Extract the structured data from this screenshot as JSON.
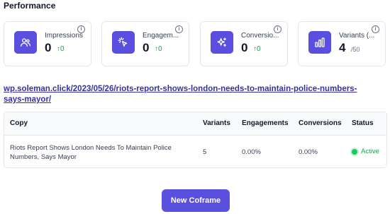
{
  "section_title": "Performance",
  "cards": [
    {
      "label": "Impressions",
      "value": "0",
      "delta": "↑0",
      "suffix": "",
      "icon": "users-icon"
    },
    {
      "label": "Engagem...",
      "value": "0",
      "delta": "↑0",
      "suffix": "",
      "icon": "pointer-click-icon"
    },
    {
      "label": "Conversio...",
      "value": "0",
      "delta": "↑0",
      "suffix": "",
      "icon": "sparkles-icon"
    },
    {
      "label": "Variants (...",
      "value": "4",
      "delta": "",
      "suffix": "/50",
      "icon": "bar-chart-icon"
    }
  ],
  "info_glyph": "i",
  "url": "wp.soleman.click/2023/05/26/riots-report-shows-london-needs-to-maintain-police-numbers-says-mayor/",
  "table": {
    "headers": [
      "Copy",
      "Variants",
      "Engagements",
      "Conversions",
      "Status"
    ],
    "rows": [
      {
        "copy": "Riots Report Shows London Needs To Maintain Police Numbers, Says Mayor",
        "variants": "5",
        "engagements": "0.00%",
        "conversions": "0.00%",
        "status": "Active"
      }
    ]
  },
  "button_label": "New Coframe",
  "colors": {
    "accent": "#5b4fe0",
    "success": "#16a34a",
    "link": "#3730a3"
  }
}
